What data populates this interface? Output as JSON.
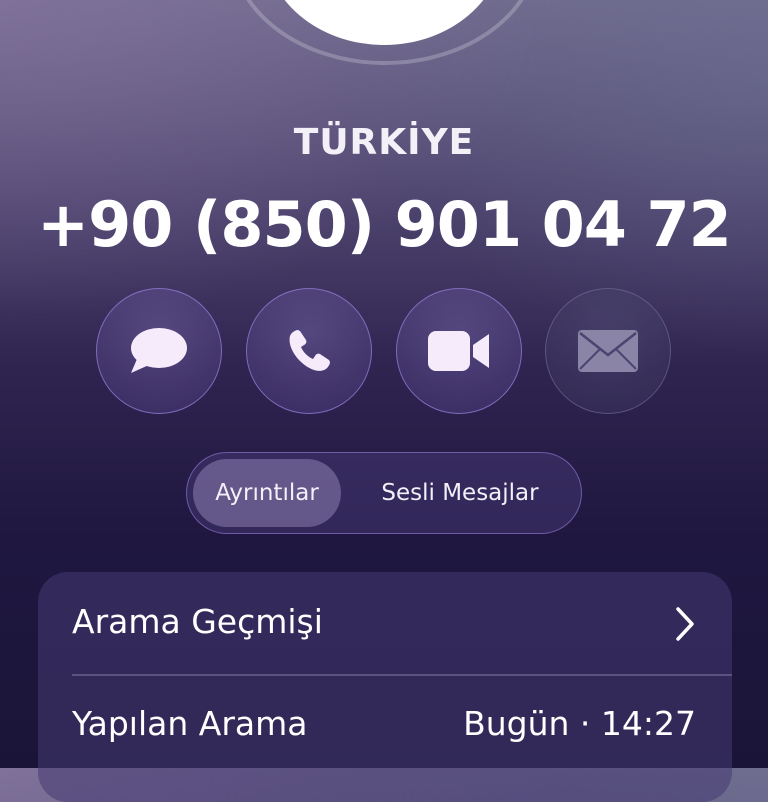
{
  "contact": {
    "country": "TÜRKİYE",
    "phone": "+90 (850) 901 04 72"
  },
  "actions": [
    {
      "name": "message",
      "icon": "message-bubble-icon"
    },
    {
      "name": "call",
      "icon": "phone-icon"
    },
    {
      "name": "video",
      "icon": "video-camera-icon"
    },
    {
      "name": "mail",
      "icon": "envelope-icon"
    }
  ],
  "segmented": {
    "items": [
      "Ayrıntılar",
      "Sesli Mesajlar"
    ],
    "selected": "Ayrıntılar"
  },
  "history": {
    "title": "Arama Geçmişi",
    "entries": [
      {
        "type": "Yapılan Arama",
        "time": "Bugün · 14:27"
      }
    ]
  },
  "colors": {
    "accent_border": "#9678d7",
    "icon_fill": "#f6ebfb",
    "mail_icon_fill": "#8a85a6"
  }
}
